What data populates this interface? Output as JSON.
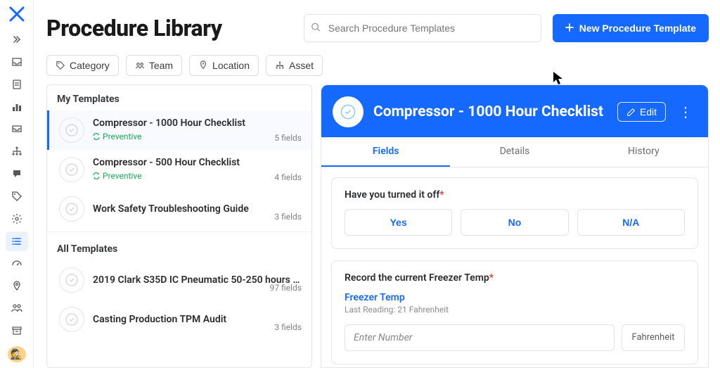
{
  "page": {
    "title": "Procedure Library"
  },
  "search": {
    "placeholder": "Search Procedure Templates"
  },
  "buttons": {
    "new_template": "New Procedure Template",
    "edit": "Edit"
  },
  "filters": [
    {
      "label": "Category",
      "icon": "tag"
    },
    {
      "label": "Team",
      "icon": "team"
    },
    {
      "label": "Location",
      "icon": "location"
    },
    {
      "label": "Asset",
      "icon": "asset"
    }
  ],
  "sections": {
    "my": "My Templates",
    "all": "All Templates"
  },
  "my_templates": [
    {
      "name": "Compressor - 1000 Hour Checklist",
      "tag": "Preventive",
      "fields": "5 fields",
      "selected": true
    },
    {
      "name": "Compressor - 500 Hour Checklist",
      "tag": "Preventive",
      "fields": "4 fields"
    },
    {
      "name": "Work Safety Troubleshooting Guide",
      "fields": "3 fields"
    }
  ],
  "all_templates": [
    {
      "name": "2019 Clark S35D IC Pneumatic 50-250 hours D...",
      "fields": "97 fields"
    },
    {
      "name": "Casting Production TPM Audit",
      "fields": "3 fields"
    }
  ],
  "detail": {
    "title": "Compressor - 1000 Hour Checklist",
    "tabs": [
      {
        "label": "Fields",
        "active": true
      },
      {
        "label": "Details"
      },
      {
        "label": "History"
      }
    ],
    "fields": [
      {
        "type": "options",
        "label": "Have you turned it off",
        "required": true,
        "options": [
          "Yes",
          "No",
          "N/A"
        ]
      },
      {
        "type": "number",
        "label": "Record the current Freezer Temp",
        "required": true,
        "link": "Freezer Temp",
        "last_reading": "Last Reading: 21 Fahrenheit",
        "placeholder": "Enter Number",
        "unit": "Fahrenheit"
      }
    ]
  },
  "sidebar_avatar": "🕵️"
}
